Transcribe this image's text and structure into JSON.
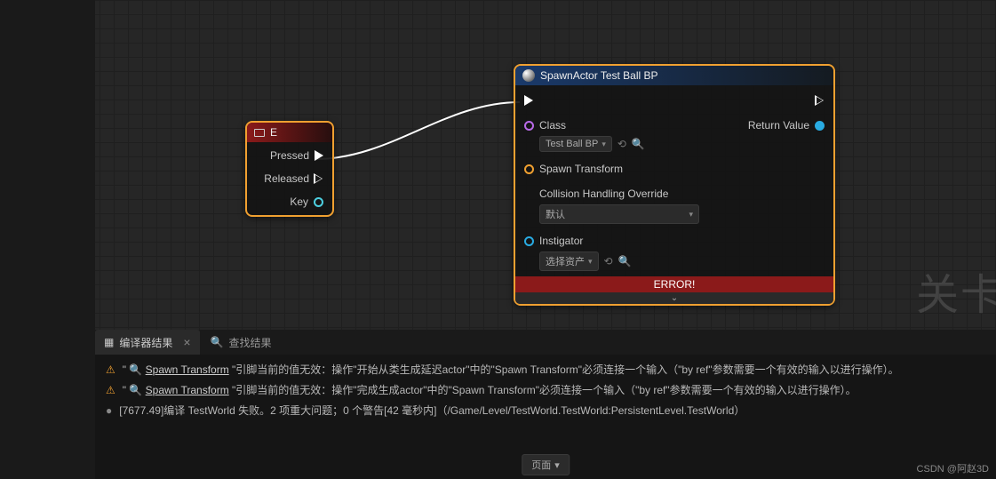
{
  "watermark": "关卡",
  "nodes": {
    "input_key": {
      "title": "E",
      "pins": {
        "pressed": "Pressed",
        "released": "Released",
        "key": "Key"
      }
    },
    "spawn": {
      "title": "SpawnActor Test Ball BP",
      "class_label": "Class",
      "class_value": "Test Ball BP",
      "return_label": "Return Value",
      "spawn_transform": "Spawn Transform",
      "collision_label": "Collision Handling Override",
      "collision_value": "默认",
      "instigator_label": "Instigator",
      "instigator_value": "选择资产",
      "error": "ERROR!"
    }
  },
  "bottom": {
    "tab_label": "编译器结果",
    "search_label": "查找结果",
    "messages": [
      {
        "type": "warning",
        "quote_open": "\" ",
        "link": "Spawn Transform",
        "text": " \"引脚当前的值无效：操作\"开始从类生成延迟actor\"中的\"Spawn Transform\"必须连接一个输入（\"by ref\"参数需要一个有效的输入以进行操作）。"
      },
      {
        "type": "warning",
        "quote_open": "\" ",
        "link": "Spawn Transform",
        "text": " \"引脚当前的值无效：操作\"完成生成actor\"中的\"Spawn Transform\"必须连接一个输入（\"by ref\"参数需要一个有效的输入以进行操作）。"
      },
      {
        "type": "info",
        "text": "[7677.49]编译 TestWorld 失败。2 项重大问题；0 个警告[42 毫秒内]（/Game/Level/TestWorld.TestWorld:PersistentLevel.TestWorld）"
      }
    ],
    "footer_btn": "页面",
    "credits": "CSDN @阿赵3D"
  }
}
